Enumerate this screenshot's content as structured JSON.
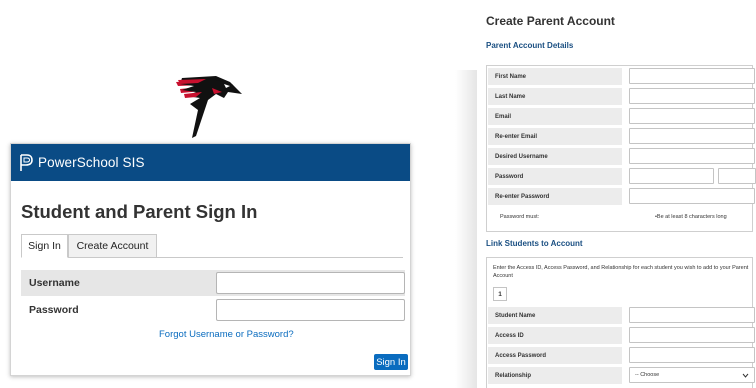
{
  "signin_card": {
    "brand": "PowerSchool SIS",
    "heading": "Student and Parent Sign In",
    "tabs": [
      {
        "label": "Sign In",
        "active": true
      },
      {
        "label": "Create Account",
        "active": false
      }
    ],
    "fields": [
      {
        "label": "Username",
        "value": ""
      },
      {
        "label": "Password",
        "value": ""
      }
    ],
    "forgot_link": "Forgot Username or Password?",
    "submit_label": "Sign In"
  },
  "create_account": {
    "title": "Create Parent Account",
    "details_section": "Parent Account Details",
    "details_fields": [
      {
        "label": "First Name",
        "value": ""
      },
      {
        "label": "Last Name",
        "value": ""
      },
      {
        "label": "Email",
        "value": ""
      },
      {
        "label": "Re-enter Email",
        "value": ""
      },
      {
        "label": "Desired Username",
        "value": ""
      },
      {
        "label": "Password",
        "value": ""
      },
      {
        "label": "Re-enter Password",
        "value": ""
      }
    ],
    "password_must_label": "Password must:",
    "password_rule": "•Be at least 8 characters long",
    "link_section": "Link Students to Account",
    "link_instructions": "Enter the Access ID, Access Password, and Relationship for each student you wish to add to your Parent Account",
    "student_tab": "1",
    "student_fields": [
      {
        "label": "Student Name",
        "value": ""
      },
      {
        "label": "Access ID",
        "value": ""
      },
      {
        "label": "Access Password",
        "value": ""
      }
    ],
    "relationship_label": "Relationship",
    "relationship_selected": "-- Choose"
  },
  "colors": {
    "ps_header": "#0a4b85",
    "link_blue": "#0a6cbf",
    "section_blue": "#1a4f82",
    "falcon_red": "#c8102e",
    "falcon_black": "#111111"
  }
}
